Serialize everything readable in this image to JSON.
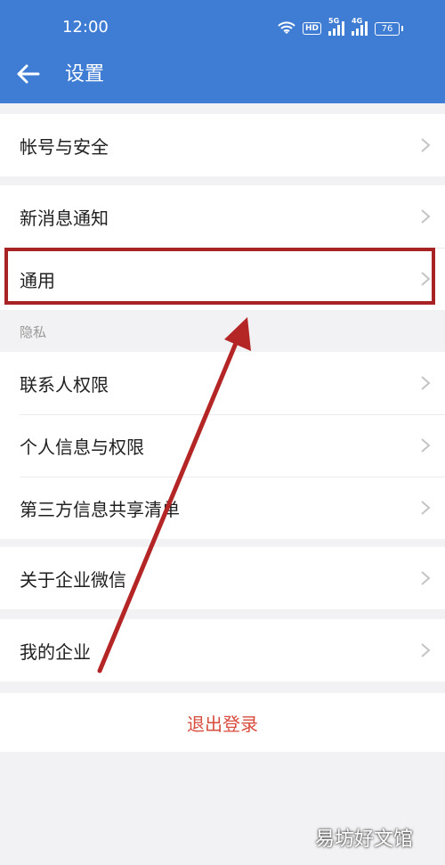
{
  "status_bar": {
    "time": "12:00",
    "hd_badge": "HD",
    "signal_1_label": "5G",
    "signal_2_label": "4G",
    "battery": "76"
  },
  "header": {
    "title": "设置"
  },
  "groups": {
    "account": {
      "label": "帐号与安全"
    },
    "notify": {
      "label": "新消息通知"
    },
    "general": {
      "label": "通用"
    },
    "privacy_section": "隐私",
    "contacts": {
      "label": "联系人权限"
    },
    "personal": {
      "label": "个人信息与权限"
    },
    "third_party": {
      "label": "第三方信息共享清单"
    },
    "about": {
      "label": "关于企业微信"
    },
    "my_company": {
      "label": "我的企业"
    }
  },
  "logout": {
    "label": "退出登录"
  },
  "watermark": "易坊好文馆",
  "colors": {
    "header_bg": "#3f7cd3",
    "logout_text": "#d84c3e",
    "highlight": "#a82323"
  }
}
